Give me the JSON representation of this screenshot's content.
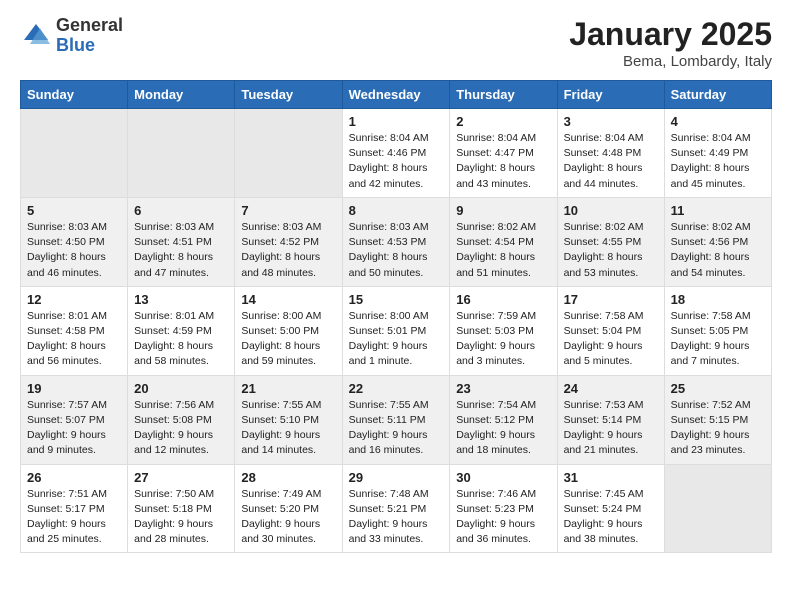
{
  "logo": {
    "general": "General",
    "blue": "Blue"
  },
  "header": {
    "month": "January 2025",
    "location": "Bema, Lombardy, Italy"
  },
  "weekdays": [
    "Sunday",
    "Monday",
    "Tuesday",
    "Wednesday",
    "Thursday",
    "Friday",
    "Saturday"
  ],
  "weeks": [
    [
      {
        "day": "",
        "info": ""
      },
      {
        "day": "",
        "info": ""
      },
      {
        "day": "",
        "info": ""
      },
      {
        "day": "1",
        "info": "Sunrise: 8:04 AM\nSunset: 4:46 PM\nDaylight: 8 hours and 42 minutes."
      },
      {
        "day": "2",
        "info": "Sunrise: 8:04 AM\nSunset: 4:47 PM\nDaylight: 8 hours and 43 minutes."
      },
      {
        "day": "3",
        "info": "Sunrise: 8:04 AM\nSunset: 4:48 PM\nDaylight: 8 hours and 44 minutes."
      },
      {
        "day": "4",
        "info": "Sunrise: 8:04 AM\nSunset: 4:49 PM\nDaylight: 8 hours and 45 minutes."
      }
    ],
    [
      {
        "day": "5",
        "info": "Sunrise: 8:03 AM\nSunset: 4:50 PM\nDaylight: 8 hours and 46 minutes."
      },
      {
        "day": "6",
        "info": "Sunrise: 8:03 AM\nSunset: 4:51 PM\nDaylight: 8 hours and 47 minutes."
      },
      {
        "day": "7",
        "info": "Sunrise: 8:03 AM\nSunset: 4:52 PM\nDaylight: 8 hours and 48 minutes."
      },
      {
        "day": "8",
        "info": "Sunrise: 8:03 AM\nSunset: 4:53 PM\nDaylight: 8 hours and 50 minutes."
      },
      {
        "day": "9",
        "info": "Sunrise: 8:02 AM\nSunset: 4:54 PM\nDaylight: 8 hours and 51 minutes."
      },
      {
        "day": "10",
        "info": "Sunrise: 8:02 AM\nSunset: 4:55 PM\nDaylight: 8 hours and 53 minutes."
      },
      {
        "day": "11",
        "info": "Sunrise: 8:02 AM\nSunset: 4:56 PM\nDaylight: 8 hours and 54 minutes."
      }
    ],
    [
      {
        "day": "12",
        "info": "Sunrise: 8:01 AM\nSunset: 4:58 PM\nDaylight: 8 hours and 56 minutes."
      },
      {
        "day": "13",
        "info": "Sunrise: 8:01 AM\nSunset: 4:59 PM\nDaylight: 8 hours and 58 minutes."
      },
      {
        "day": "14",
        "info": "Sunrise: 8:00 AM\nSunset: 5:00 PM\nDaylight: 8 hours and 59 minutes."
      },
      {
        "day": "15",
        "info": "Sunrise: 8:00 AM\nSunset: 5:01 PM\nDaylight: 9 hours and 1 minute."
      },
      {
        "day": "16",
        "info": "Sunrise: 7:59 AM\nSunset: 5:03 PM\nDaylight: 9 hours and 3 minutes."
      },
      {
        "day": "17",
        "info": "Sunrise: 7:58 AM\nSunset: 5:04 PM\nDaylight: 9 hours and 5 minutes."
      },
      {
        "day": "18",
        "info": "Sunrise: 7:58 AM\nSunset: 5:05 PM\nDaylight: 9 hours and 7 minutes."
      }
    ],
    [
      {
        "day": "19",
        "info": "Sunrise: 7:57 AM\nSunset: 5:07 PM\nDaylight: 9 hours and 9 minutes."
      },
      {
        "day": "20",
        "info": "Sunrise: 7:56 AM\nSunset: 5:08 PM\nDaylight: 9 hours and 12 minutes."
      },
      {
        "day": "21",
        "info": "Sunrise: 7:55 AM\nSunset: 5:10 PM\nDaylight: 9 hours and 14 minutes."
      },
      {
        "day": "22",
        "info": "Sunrise: 7:55 AM\nSunset: 5:11 PM\nDaylight: 9 hours and 16 minutes."
      },
      {
        "day": "23",
        "info": "Sunrise: 7:54 AM\nSunset: 5:12 PM\nDaylight: 9 hours and 18 minutes."
      },
      {
        "day": "24",
        "info": "Sunrise: 7:53 AM\nSunset: 5:14 PM\nDaylight: 9 hours and 21 minutes."
      },
      {
        "day": "25",
        "info": "Sunrise: 7:52 AM\nSunset: 5:15 PM\nDaylight: 9 hours and 23 minutes."
      }
    ],
    [
      {
        "day": "26",
        "info": "Sunrise: 7:51 AM\nSunset: 5:17 PM\nDaylight: 9 hours and 25 minutes."
      },
      {
        "day": "27",
        "info": "Sunrise: 7:50 AM\nSunset: 5:18 PM\nDaylight: 9 hours and 28 minutes."
      },
      {
        "day": "28",
        "info": "Sunrise: 7:49 AM\nSunset: 5:20 PM\nDaylight: 9 hours and 30 minutes."
      },
      {
        "day": "29",
        "info": "Sunrise: 7:48 AM\nSunset: 5:21 PM\nDaylight: 9 hours and 33 minutes."
      },
      {
        "day": "30",
        "info": "Sunrise: 7:46 AM\nSunset: 5:23 PM\nDaylight: 9 hours and 36 minutes."
      },
      {
        "day": "31",
        "info": "Sunrise: 7:45 AM\nSunset: 5:24 PM\nDaylight: 9 hours and 38 minutes."
      },
      {
        "day": "",
        "info": ""
      }
    ]
  ]
}
